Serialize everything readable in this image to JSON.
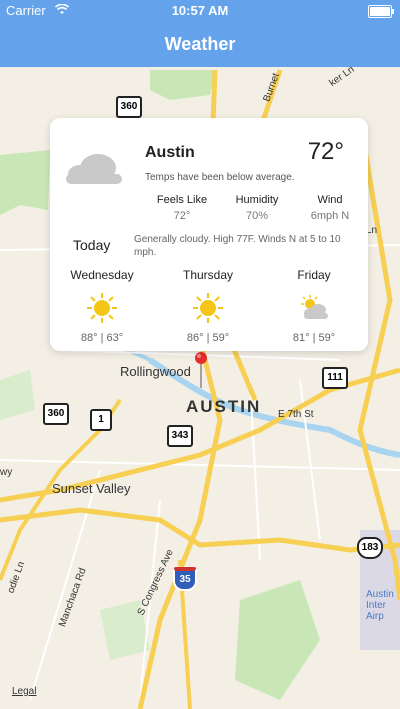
{
  "status_bar": {
    "carrier": "Carrier",
    "time": "10:57 AM"
  },
  "nav": {
    "title": "Weather"
  },
  "map": {
    "labels": {
      "rollingwood": "Rollingwood",
      "austin": "AUSTIN",
      "sunset_valley": "Sunset Valley",
      "e7th": "E 7th St",
      "burnet": "Burnet",
      "kerln": "ker Ln",
      "manchaca": "Manchaca Rd",
      "congress": "S Congress Ave",
      "airport": "Austin Inter Airp",
      "lnLabel": "Ln",
      "oodieln": "odie Ln",
      "way": "wy"
    },
    "shields": {
      "s360_top": "360",
      "s360_left": "360",
      "s1": "1",
      "s343": "343",
      "s111": "111",
      "s183": "183",
      "i35": "35"
    },
    "legal": "Legal"
  },
  "weather": {
    "city": "Austin",
    "current_temp": "72°",
    "summary": "Temps have been below average.",
    "stats": [
      {
        "label": "Feels Like",
        "value": "72°"
      },
      {
        "label": "Humidity",
        "value": "70%"
      },
      {
        "label": "Wind",
        "value": "6mph N"
      }
    ],
    "today_label": "Today",
    "today_desc": "Generally cloudy. High 77F. Winds N at 5 to 10 mph.",
    "forecast": [
      {
        "day": "Wednesday",
        "temps": "88° | 63°",
        "icon": "sun-icon"
      },
      {
        "day": "Thursday",
        "temps": "86° | 59°",
        "icon": "sun-icon"
      },
      {
        "day": "Friday",
        "temps": "81° | 59°",
        "icon": "partly-cloudy-icon"
      }
    ]
  }
}
